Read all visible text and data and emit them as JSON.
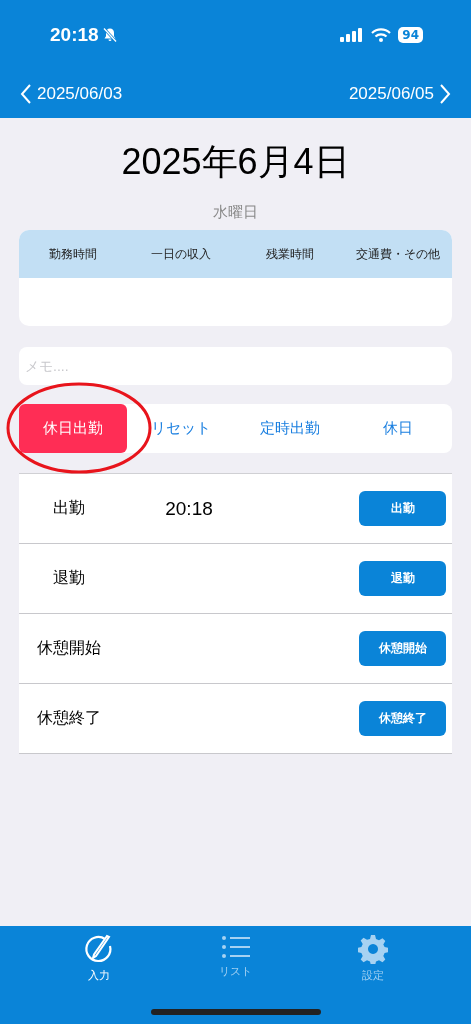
{
  "status_bar": {
    "time": "20:18",
    "battery": "94"
  },
  "nav": {
    "prev": "2025/06/03",
    "next": "2025/06/05"
  },
  "date": {
    "title": "2025年6月4日",
    "weekday": "水曜日"
  },
  "summary": {
    "columns": [
      "勤務時間",
      "一日の収入",
      "残業時間",
      "交通費・その他"
    ]
  },
  "memo": {
    "placeholder": "メモ...."
  },
  "segments": [
    {
      "label": "休日出勤",
      "selected": true,
      "circled": true
    },
    {
      "label": "リセット",
      "selected": false,
      "circled": false
    },
    {
      "label": "定時出勤",
      "selected": false,
      "circled": false
    },
    {
      "label": "休日",
      "selected": false,
      "circled": false
    }
  ],
  "records": [
    {
      "label": "出勤",
      "time": "20:18",
      "button": "出勤"
    },
    {
      "label": "退勤",
      "button": "退勤"
    },
    {
      "label": "休憩開始",
      "button": "休憩開始"
    },
    {
      "label": "休憩終了",
      "button": "休憩終了"
    }
  ],
  "tabs": [
    {
      "label": "入力",
      "kind": "input",
      "selected": true
    },
    {
      "label": "リスト",
      "kind": "list",
      "selected": false
    },
    {
      "label": "設定",
      "kind": "settings",
      "selected": false
    }
  ]
}
